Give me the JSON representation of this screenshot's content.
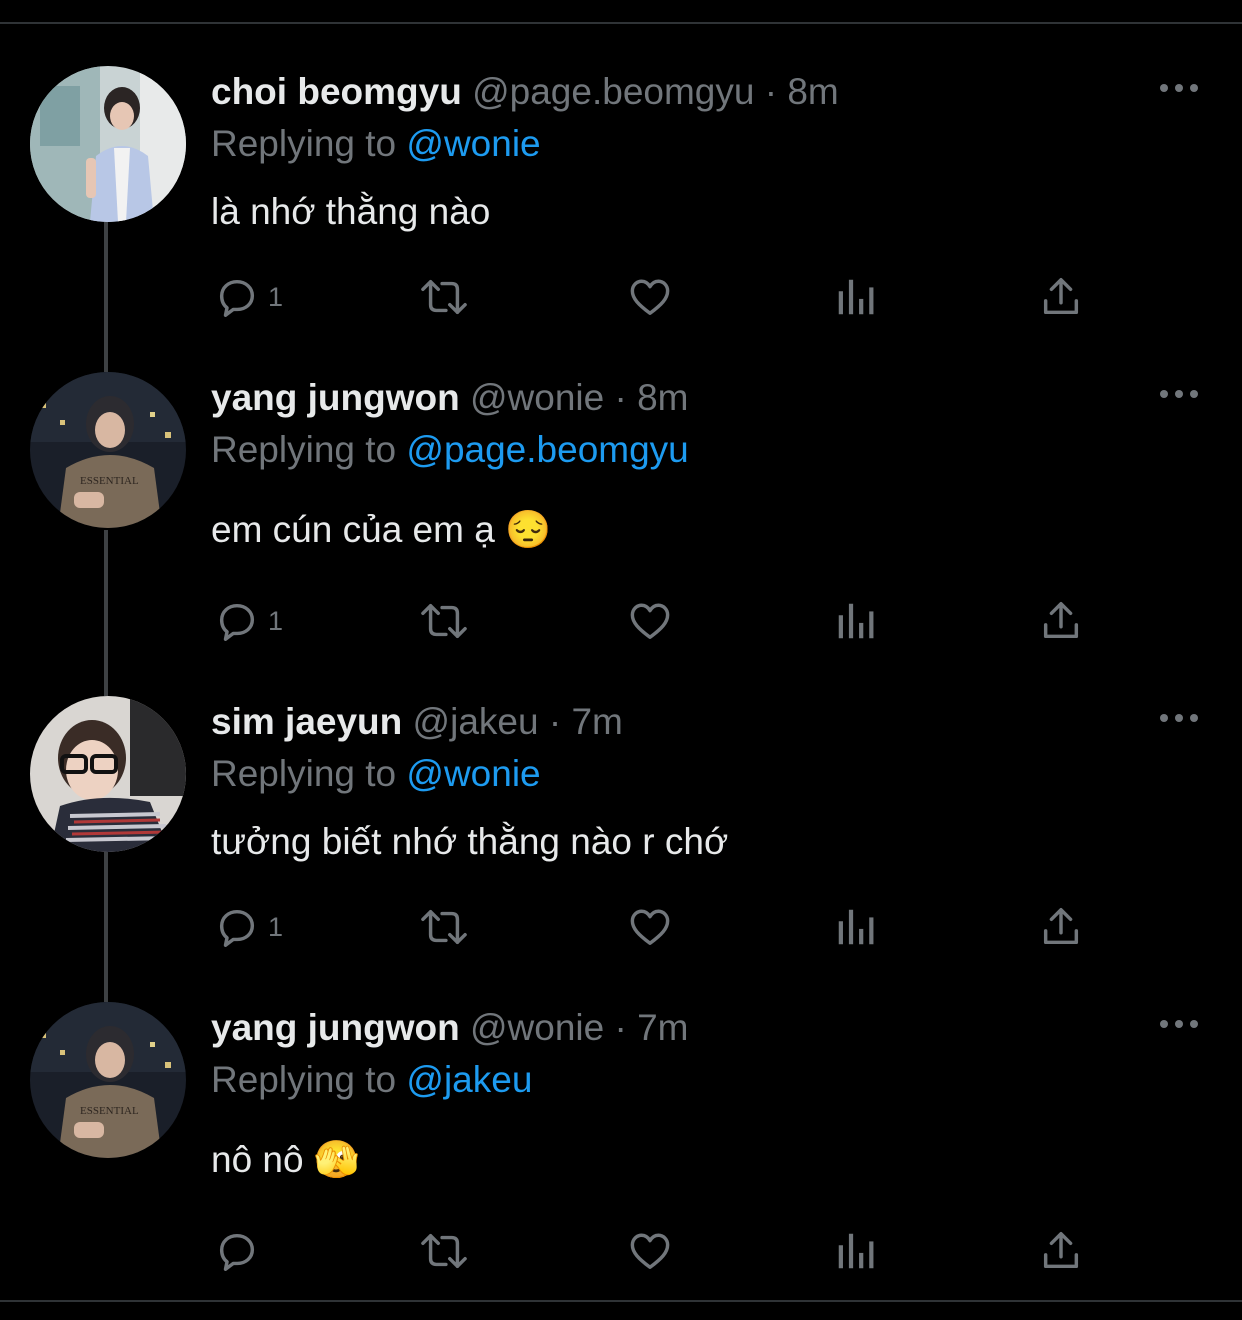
{
  "colors": {
    "background": "#000000",
    "primary_text": "#e7e9ea",
    "secondary_text": "#71767b",
    "mention": "#1d9bf0",
    "divider": "#2f3336",
    "thread_line": "#3e4144"
  },
  "tweets": [
    {
      "display_name": "choi beomgyu",
      "handle": "@page.beomgyu",
      "time": "· 8m",
      "replying_prefix": "Replying to",
      "replying_to": "@wonie",
      "text": "là nhớ thằng nào",
      "reply_count": "1",
      "avatar": "avatar-photo-light-background"
    },
    {
      "display_name": "yang jungwon",
      "handle": "@wonie",
      "time": "· 8m",
      "replying_prefix": "Replying to",
      "replying_to": "@page.beomgyu",
      "text": "em cún của em ạ 😔",
      "reply_count": "1",
      "avatar": "avatar-photo-dark-night-hoodie"
    },
    {
      "display_name": "sim jaeyun",
      "handle": "@jakeu",
      "time": "· 7m",
      "replying_prefix": "Replying to",
      "replying_to": "@wonie",
      "text": "tưởng biết nhớ thằng nào r chớ",
      "reply_count": "1",
      "avatar": "avatar-photo-glasses"
    },
    {
      "display_name": "yang jungwon",
      "handle": "@wonie",
      "time": "· 7m",
      "replying_prefix": "Replying to",
      "replying_to": "@jakeu",
      "text": "nô nô 🫣",
      "reply_count": "",
      "avatar": "avatar-photo-dark-night-hoodie"
    }
  ],
  "icons": {
    "reply": "reply-icon",
    "retweet": "retweet-icon",
    "like": "like-icon",
    "views": "views-icon",
    "share": "share-icon",
    "more": "more-icon"
  }
}
